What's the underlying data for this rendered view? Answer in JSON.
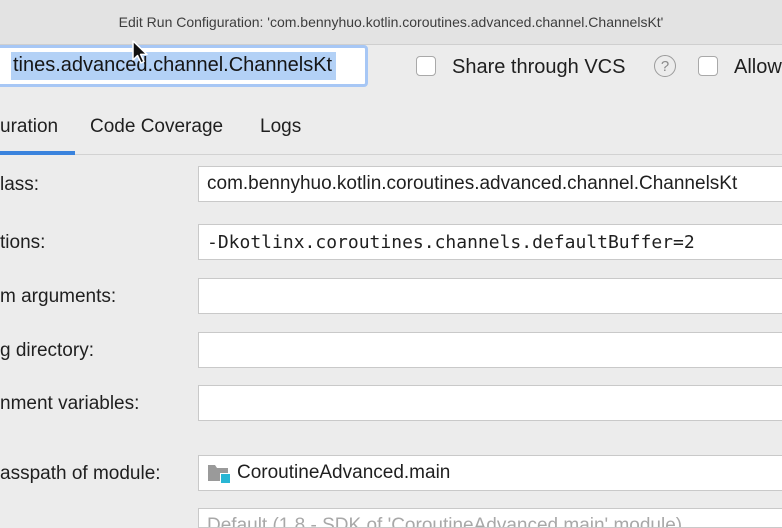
{
  "window": {
    "title": "Edit Run Configuration: 'com.bennyhuo.kotlin.coroutines.advanced.channel.ChannelsKt'"
  },
  "header": {
    "name_value": "tines.advanced.channel.ChannelsKt",
    "share_vcs_label": "Share through VCS",
    "allow_label": "Allow",
    "help_glyph": "?"
  },
  "tabs": [
    {
      "label": "uration",
      "active": true
    },
    {
      "label": "Code Coverage",
      "active": false
    },
    {
      "label": "Logs",
      "active": false
    }
  ],
  "form": {
    "main_class": {
      "label": "lass:",
      "value": "com.bennyhuo.kotlin.coroutines.advanced.channel.ChannelsKt"
    },
    "vm_options": {
      "label": "tions:",
      "value": "-Dkotlinx.coroutines.channels.defaultBuffer=2"
    },
    "program_arguments": {
      "label": "m arguments:",
      "value": ""
    },
    "working_directory": {
      "label": "g directory:",
      "value": ""
    },
    "environment_variables": {
      "label": "nment variables:",
      "value": ""
    },
    "classpath_module": {
      "label": "asspath of module:",
      "value": "CoroutineAdvanced.main"
    },
    "jre": {
      "value": "Default (1.8 - SDK of 'CoroutineAdvanced.main' module)"
    }
  },
  "icons": {
    "module": "module-folder-icon",
    "cursor": "mouse-pointer-icon"
  },
  "colors": {
    "selection": "#b3d1f6",
    "focus_ring": "#a7c7f5",
    "tab_accent": "#3a83dd",
    "module_badge": "#29b6d4"
  }
}
